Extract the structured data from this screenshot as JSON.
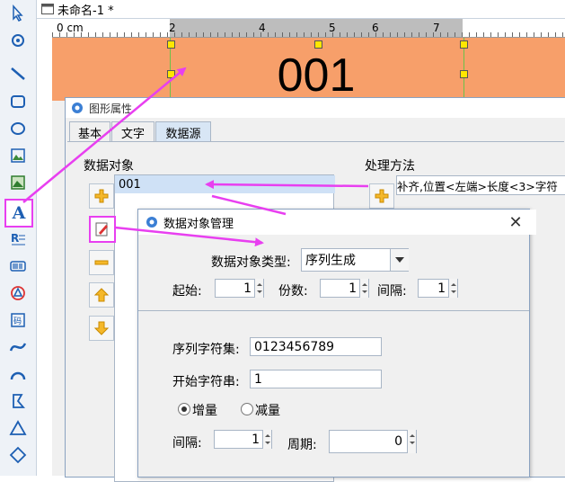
{
  "document": {
    "tab_title": "未命名-1 *"
  },
  "ruler": {
    "unit_label": "0 cm",
    "marks": [
      "2",
      "4",
      "5",
      "6",
      "7"
    ]
  },
  "canvas": {
    "barcode_text": "001",
    "label_color": "#f79f6a"
  },
  "property_dialog": {
    "title": "图形属性",
    "tabs": [
      "基本",
      "文字",
      "数据源"
    ],
    "data_objects_label": "数据对象",
    "data_objects": [
      "001"
    ],
    "processing_label": "处理方法",
    "processing_item": "补齐,位置<左端>长度<3>字符"
  },
  "manager_dialog": {
    "title": "数据对象管理",
    "close_label": "✕",
    "type_label": "数据对象类型:",
    "type_value": "序列生成",
    "start_label": "起始:",
    "start_value": "1",
    "copies_label": "份数:",
    "copies_value": "1",
    "interval_label": "间隔:",
    "interval_value": "1",
    "charset_label": "序列字符集:",
    "charset_value": "0123456789",
    "start_string_label": "开始字符串:",
    "start_string_value": "1",
    "increment_label": "增量",
    "decrement_label": "减量",
    "step_label": "间隔:",
    "step_value": "1",
    "period_label": "周期:",
    "period_value": "0"
  },
  "colors": {
    "annotation_arrow": "#e83ff0",
    "selection": "#cfe1f6"
  }
}
